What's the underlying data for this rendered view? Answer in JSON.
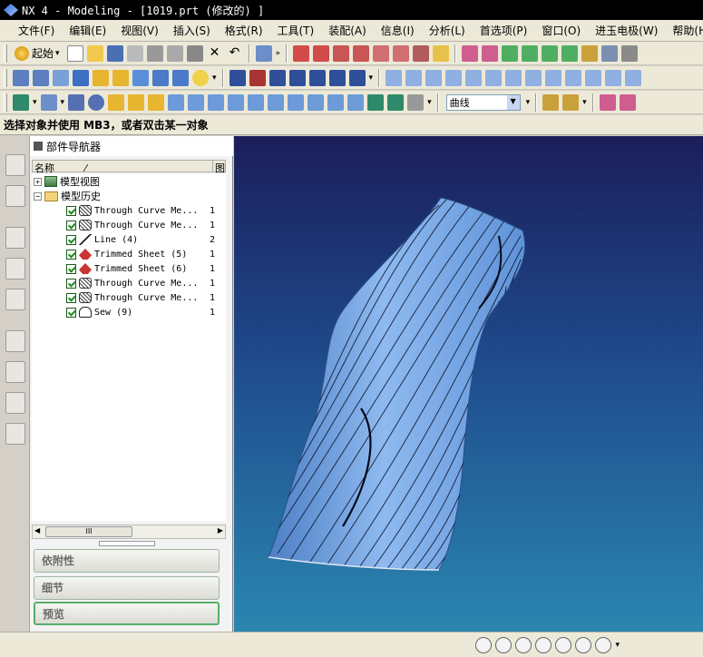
{
  "window": {
    "title": "NX 4 - Modeling - [1019.prt (修改的) ]"
  },
  "menu": {
    "items": [
      "文件(F)",
      "编辑(E)",
      "视图(V)",
      "插入(S)",
      "格式(R)",
      "工具(T)",
      "装配(A)",
      "信息(I)",
      "分析(L)",
      "首选项(P)",
      "窗口(O)",
      "进玉电极(W)",
      "帮助(H)"
    ]
  },
  "toolbar": {
    "start_label": "起始",
    "filter_combo_value": "曲线",
    "chevron": "»"
  },
  "cue_line": "选择对象并使用 MB3，或者双击某一对象",
  "navigator": {
    "title": "部件导航器",
    "col_name": "名称",
    "col_sort": "⁄",
    "col_extra": "图",
    "tree": [
      {
        "label": "模型视图",
        "expander": "+",
        "icon": "view-icon",
        "level": 0
      },
      {
        "label": "模型历史",
        "expander": "−",
        "icon": "folder-icon",
        "level": 0
      },
      {
        "label": "Through Curve Me...",
        "num": "1",
        "icon": "through-curve-mesh-icon",
        "level": 1
      },
      {
        "label": "Through Curve Me...",
        "num": "1",
        "icon": "through-curve-mesh-icon",
        "level": 1
      },
      {
        "label": "Line (4)",
        "num": "2",
        "icon": "line-icon",
        "level": 1
      },
      {
        "label": "Trimmed Sheet (5)",
        "num": "1",
        "icon": "trimmed-sheet-icon",
        "level": 1
      },
      {
        "label": "Trimmed Sheet (6)",
        "num": "1",
        "icon": "trimmed-sheet-icon",
        "level": 1
      },
      {
        "label": "Through Curve Me...",
        "num": "1",
        "icon": "through-curve-mesh-icon",
        "level": 1
      },
      {
        "label": "Through Curve Me...",
        "num": "1",
        "icon": "through-curve-mesh-icon",
        "level": 1
      },
      {
        "label": "Sew (9)",
        "num": "1",
        "icon": "sew-icon",
        "level": 1
      }
    ],
    "scroll_thumb_label": "III",
    "panels": [
      "依附性",
      "细节",
      "预览"
    ]
  },
  "colors": {
    "viewport_top": "#1b1e5a",
    "viewport_bottom": "#2a86b0",
    "surface": "#7aa8e0",
    "checkbox": "#1c8c1c"
  }
}
